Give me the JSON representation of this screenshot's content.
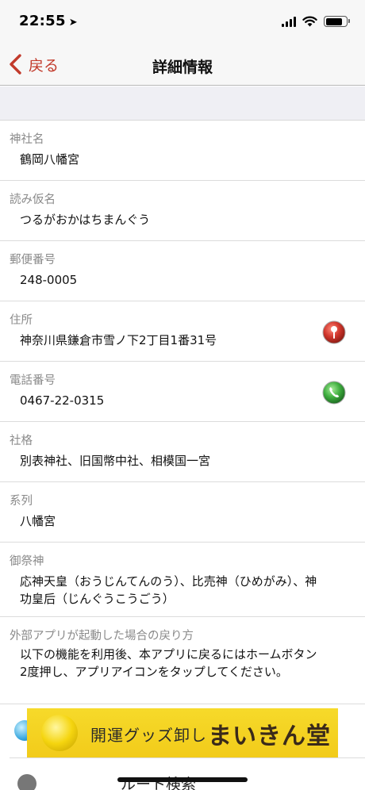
{
  "status": {
    "time": "22:55",
    "location_arrow": "➤"
  },
  "nav": {
    "back_label": "戻る",
    "title": "詳細情報"
  },
  "fields": [
    {
      "label": "神社名",
      "value": "鶴岡八幡宮"
    },
    {
      "label": "読み仮名",
      "value": "つるがおかはちまんぐう"
    },
    {
      "label": "郵便番号",
      "value": "248-0005"
    },
    {
      "label": "住所",
      "value": "神奈川県鎌倉市雪ノ下2丁目1番31号",
      "icon": "map-pin-icon"
    },
    {
      "label": "電話番号",
      "value": "0467-22-0315",
      "icon": "phone-icon"
    },
    {
      "label": "社格",
      "value": "別表神社、旧国幣中社、相模国一宮"
    },
    {
      "label": "系列",
      "value": "八幡宮"
    },
    {
      "label": "御祭神",
      "value": "応神天皇（おうじんてんのう）、比売神（ひめがみ）、神功皇后（じんぐうこうごう）"
    },
    {
      "label": "外部アプリが起動した場合の戻り方",
      "value": "以下の機能を利用後、本アプリに戻るにはホームボタン2度押し、アプリアイコンをタップしてください。"
    }
  ],
  "ad": {
    "text_small": "開運グッズ卸し",
    "text_large": "まいきん堂"
  },
  "route": {
    "label": "ルート検索"
  },
  "colors": {
    "accent_red": "#c23a2b",
    "phone_green": "#3fae3f",
    "pin_red": "#d0362c"
  }
}
